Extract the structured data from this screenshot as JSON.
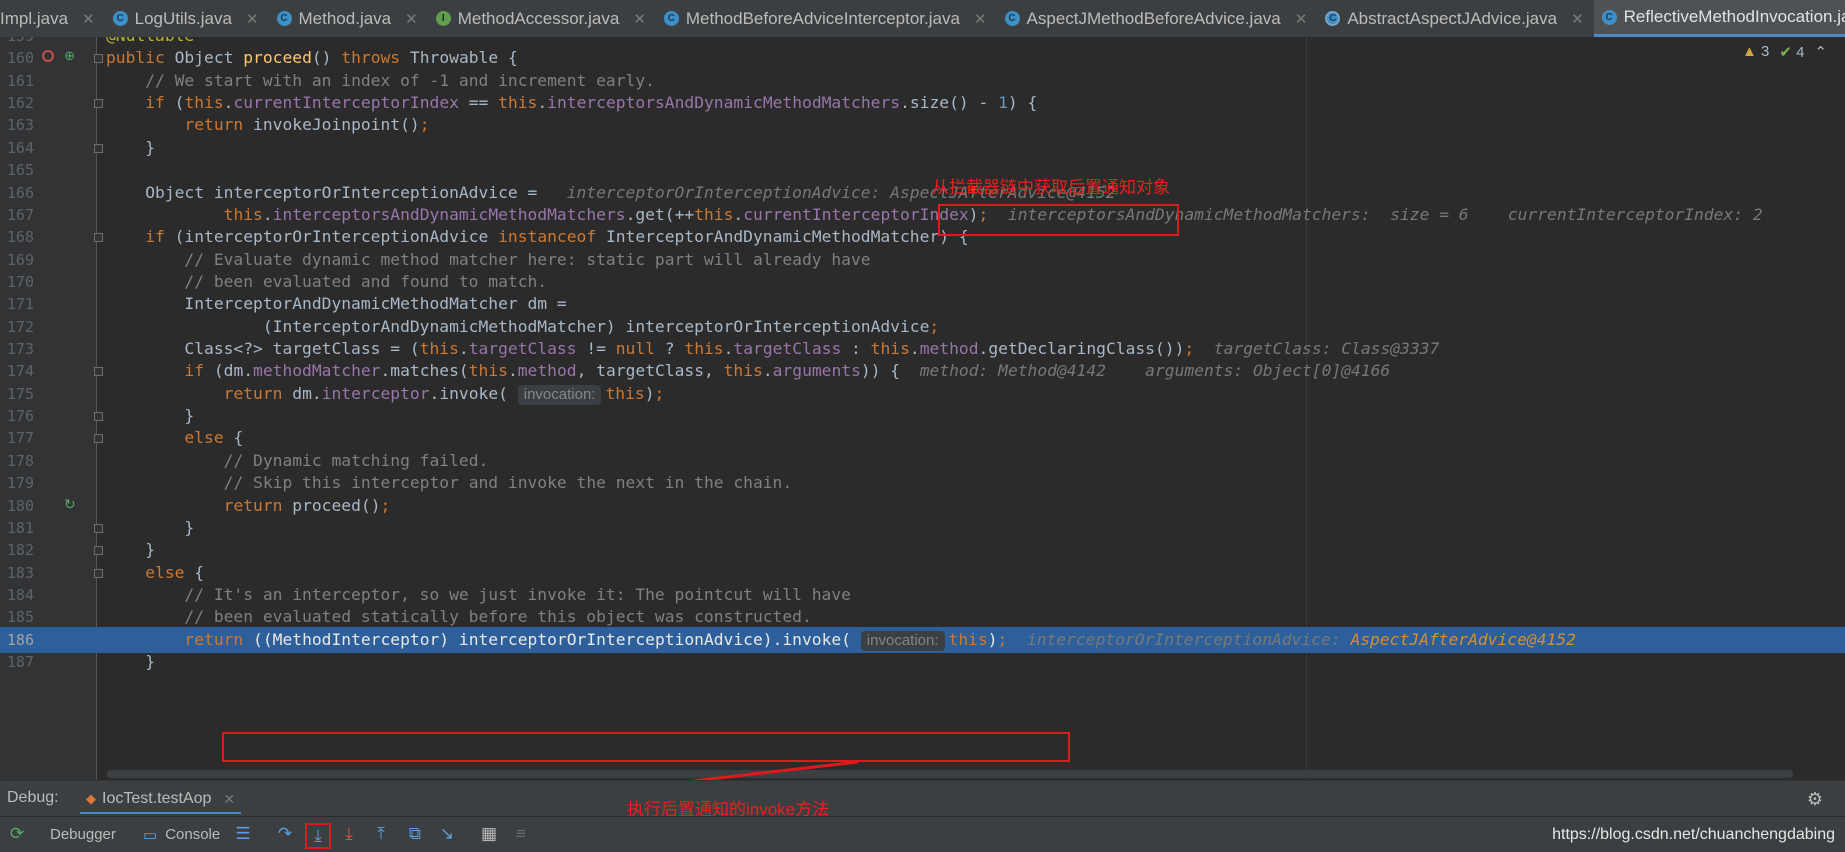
{
  "tabs": [
    {
      "label": "Impl.java",
      "icon": "none",
      "active": false
    },
    {
      "label": "LogUtils.java",
      "icon": "class-icon",
      "active": false
    },
    {
      "label": "Method.java",
      "icon": "class-icon",
      "active": false
    },
    {
      "label": "MethodAccessor.java",
      "icon": "interface-icon",
      "active": false
    },
    {
      "label": "MethodBeforeAdviceInterceptor.java",
      "icon": "class-icon",
      "active": false
    },
    {
      "label": "AspectJMethodBeforeAdvice.java",
      "icon": "class-icon",
      "active": false
    },
    {
      "label": "AbstractAspectJAdvice.java",
      "icon": "abstract-class-icon",
      "active": false
    },
    {
      "label": "ReflectiveMethodInvocation.java",
      "icon": "class-icon",
      "active": true
    }
  ],
  "inspections": {
    "warnings": "3",
    "ok": "4"
  },
  "annotations": {
    "top_note": "从拦截器链中获取后置通知对象",
    "bottom_note": "执行后置通知的invoke方法"
  },
  "lines": [
    {
      "n": "159",
      "html": "<span class=\"ann\">@Nullable</span>"
    },
    {
      "n": "160",
      "html": "<span class=\"kw\">public</span> Object <span class=\"fn\">proceed</span>() <span class=\"kw\">throws</span> Throwable {"
    },
    {
      "n": "161",
      "html": "    <span class=\"cmt\">// We start with an index of -1 and increment early.</span>"
    },
    {
      "n": "162",
      "html": "    <span class=\"kw\">if</span> (<span class=\"kw\">this</span>.<span class=\"fld\">currentInterceptorIndex</span> == <span class=\"kw\">this</span>.<span class=\"fld\">interceptorsAndDynamicMethodMatchers</span>.size() - <span class=\"num\">1</span>) {"
    },
    {
      "n": "163",
      "html": "        <span class=\"kw\">return</span> invokeJoinpoint()<span class=\"kw\">;</span>"
    },
    {
      "n": "164",
      "html": "    }"
    },
    {
      "n": "165",
      "html": ""
    },
    {
      "n": "166",
      "html": "    Object interceptorOrInterceptionAdvice =   <span class=\"dbg\">interceptorOrInterceptionAdvice: AspectJAfterAdvice@4152</span>"
    },
    {
      "n": "167",
      "html": "            <span class=\"kw\">this</span>.<span class=\"fld\">interceptorsAndDynamicMethodMatchers</span>.get(++<span class=\"kw\">this</span>.<span class=\"fld\">currentInterceptorIndex</span>)<span class=\"kw\">;</span>  <span class=\"dbg\">interceptorsAndDynamicMethodMatchers:  size = 6    currentInterceptorIndex: 2</span>"
    },
    {
      "n": "168",
      "html": "    <span class=\"kw\">if</span> (interceptorOrInterceptionAdvice <span class=\"kw\">instanceof</span> InterceptorAndDynamicMethodMatcher) {"
    },
    {
      "n": "169",
      "html": "        <span class=\"cmt\">// Evaluate dynamic method matcher here: static part will already have</span>"
    },
    {
      "n": "170",
      "html": "        <span class=\"cmt\">// been evaluated and found to match.</span>"
    },
    {
      "n": "171",
      "html": "        InterceptorAndDynamicMethodMatcher dm ="
    },
    {
      "n": "172",
      "html": "                (InterceptorAndDynamicMethodMatcher) interceptorOrInterceptionAdvice<span class=\"kw\">;</span>"
    },
    {
      "n": "173",
      "html": "        Class&lt;?&gt; targetClass = (<span class=\"kw\">this</span>.<span class=\"fld\">targetClass</span> != <span class=\"kw\">null</span> ? <span class=\"kw\">this</span>.<span class=\"fld\">targetClass</span> : <span class=\"kw\">this</span>.<span class=\"fld\">method</span>.getDeclaringClass())<span class=\"kw\">;</span>  <span class=\"dbg\">targetClass: Class@3337</span>"
    },
    {
      "n": "174",
      "html": "        <span class=\"kw\">if</span> (dm.<span class=\"fld\">methodMatcher</span>.matches(<span class=\"kw\">this</span>.<span class=\"fld\">method</span>, targetClass, <span class=\"kw\">this</span>.<span class=\"fld\">arguments</span>)) {  <span class=\"dbg\">method: Method@4142    arguments: Object[0]@4166</span>"
    },
    {
      "n": "175",
      "html": "            <span class=\"kw\">return</span> dm.<span class=\"fld\">interceptor</span>.invoke( <span class=\"hint\">invocation:</span><span class=\"kw\">this</span>)<span class=\"kw\">;</span>"
    },
    {
      "n": "176",
      "html": "        }"
    },
    {
      "n": "177",
      "html": "        <span class=\"kw\">else</span> {"
    },
    {
      "n": "178",
      "html": "            <span class=\"cmt\">// Dynamic matching failed.</span>"
    },
    {
      "n": "179",
      "html": "            <span class=\"cmt\">// Skip this interceptor and invoke the next in the chain.</span>"
    },
    {
      "n": "180",
      "html": "            <span class=\"kw\">return</span> proceed()<span class=\"kw\">;</span>"
    },
    {
      "n": "181",
      "html": "        }"
    },
    {
      "n": "182",
      "html": "    }"
    },
    {
      "n": "183",
      "html": "    <span class=\"kw\">else</span> {"
    },
    {
      "n": "184",
      "html": "        <span class=\"cmt\">// It's an interceptor, so we just invoke it: The pointcut will have</span>"
    },
    {
      "n": "185",
      "html": "        <span class=\"cmt\">// been evaluated statically before this object was constructed.</span>"
    },
    {
      "n": "186",
      "html": "        <span class=\"kw\">return</span> ((MethodInterceptor) interceptorOrInterceptionAdvice).invoke( <span class=\"hint\">invocation:</span><span class=\"kw\">this</span>)<span class=\"kw\">;</span>  <span class=\"dbg\">interceptorOrInterceptionAdvice: </span><span class=\"dbgval\">AspectJAfterAdvice@4152</span>",
      "current": true
    },
    {
      "n": "187",
      "html": "    }"
    }
  ],
  "debug": {
    "label": "Debug:",
    "session": "IocTest.testAop",
    "tabs": [
      "Debugger",
      "Console"
    ],
    "watermark": "https://blog.csdn.net/chuanchengdabing"
  }
}
